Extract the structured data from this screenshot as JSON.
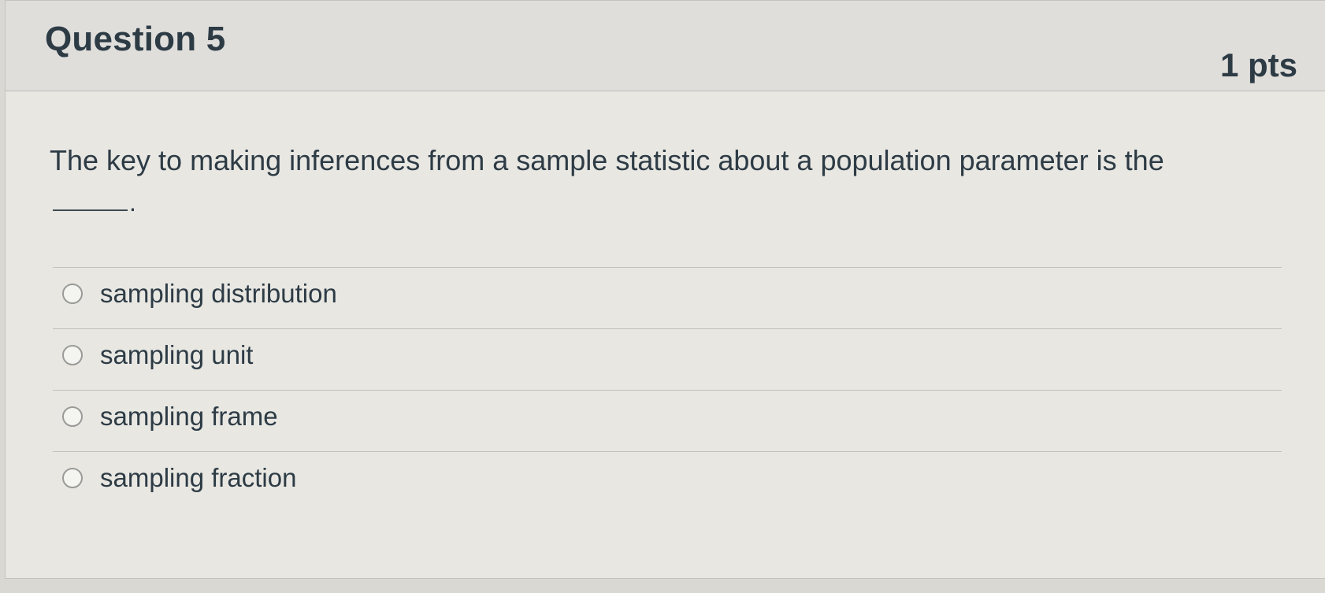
{
  "question": {
    "title": "Question 5",
    "points": "1 pts",
    "text": "The key to making inferences from a sample statistic about a population parameter is the",
    "blank_suffix": "."
  },
  "answers": [
    {
      "label": "sampling distribution",
      "selected": false
    },
    {
      "label": "sampling unit",
      "selected": false
    },
    {
      "label": "sampling frame",
      "selected": false
    },
    {
      "label": "sampling fraction",
      "selected": false
    }
  ]
}
